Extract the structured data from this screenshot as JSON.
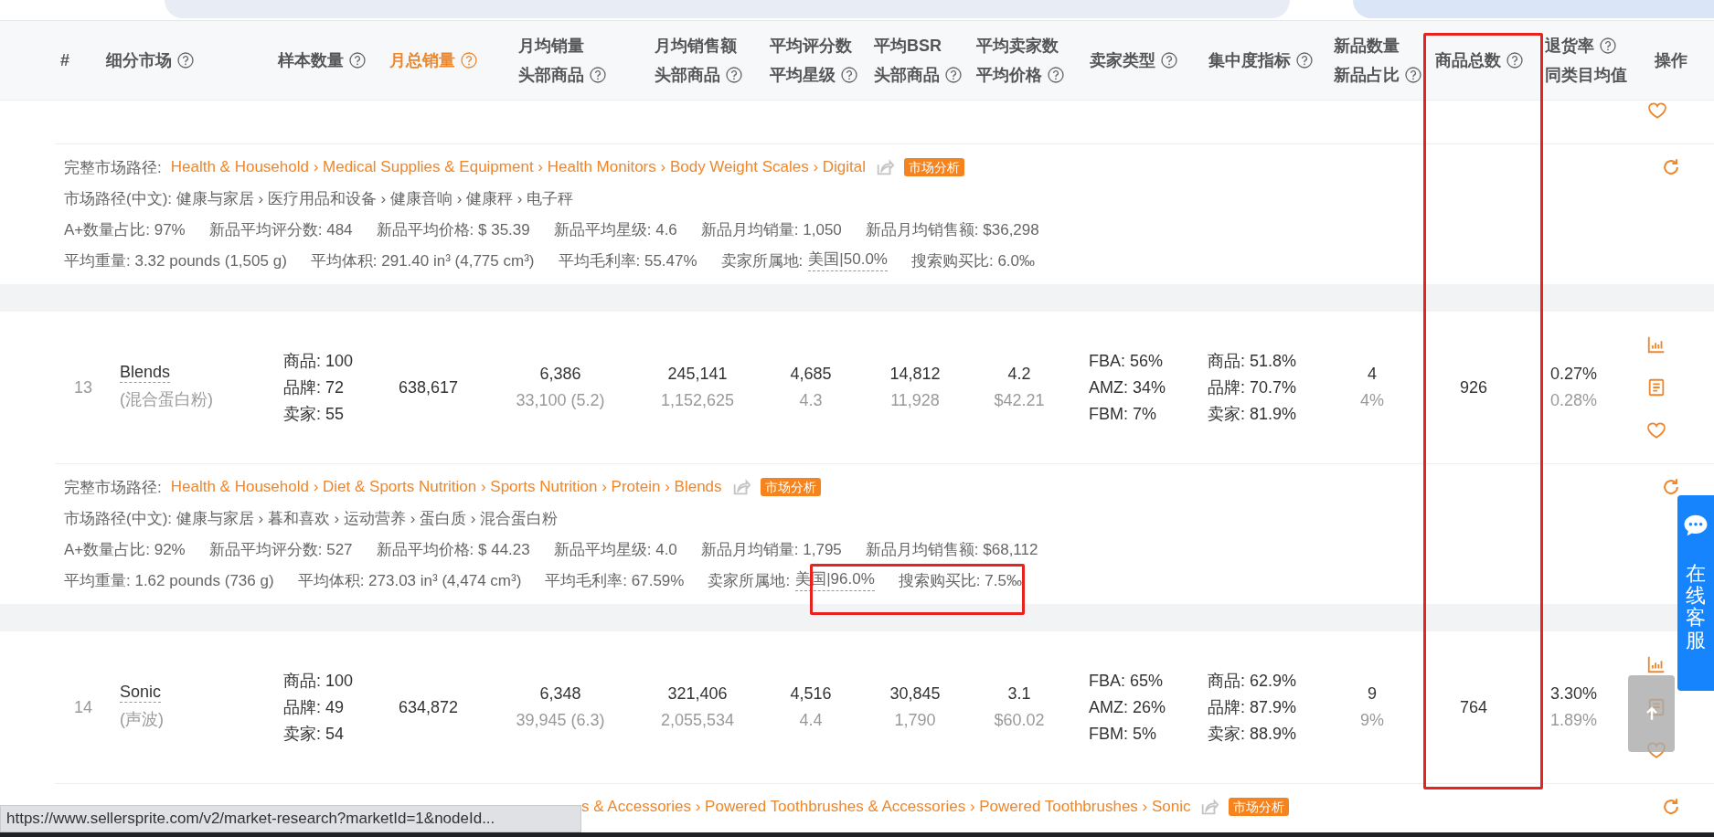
{
  "table": {
    "columns": [
      {
        "lines": [
          {
            "text": "#",
            "help": false
          }
        ],
        "sorted": false
      },
      {
        "lines": [
          {
            "text": "细分市场",
            "help": true
          }
        ],
        "sorted": false
      },
      {
        "lines": [
          {
            "text": "样本数量",
            "help": true
          }
        ],
        "sorted": false
      },
      {
        "lines": [
          {
            "text": "月总销量",
            "help": true
          }
        ],
        "sorted": true
      },
      {
        "lines": [
          {
            "text": "月均销量",
            "help": false
          },
          {
            "text": "头部商品",
            "help": true
          }
        ],
        "sorted": false
      },
      {
        "lines": [
          {
            "text": "月均销售额",
            "help": false
          },
          {
            "text": "头部商品",
            "help": true
          }
        ],
        "sorted": false
      },
      {
        "lines": [
          {
            "text": "平均评分数",
            "help": false
          },
          {
            "text": "平均星级",
            "help": true
          }
        ],
        "sorted": false
      },
      {
        "lines": [
          {
            "text": "平均BSR",
            "help": false
          },
          {
            "text": "头部商品",
            "help": true
          }
        ],
        "sorted": false
      },
      {
        "lines": [
          {
            "text": "平均卖家数",
            "help": false
          },
          {
            "text": "平均价格",
            "help": true
          }
        ],
        "sorted": false
      },
      {
        "lines": [
          {
            "text": "卖家类型",
            "help": true
          }
        ],
        "sorted": false
      },
      {
        "lines": [
          {
            "text": "集中度指标",
            "help": true
          }
        ],
        "sorted": false
      },
      {
        "lines": [
          {
            "text": "新品数量",
            "help": false
          },
          {
            "text": "新品占比",
            "help": true
          }
        ],
        "sorted": false
      },
      {
        "lines": [
          {
            "text": "商品总数",
            "help": true
          }
        ],
        "sorted": false
      },
      {
        "lines": [
          {
            "text": "退货率",
            "help": true
          },
          {
            "text": "同类目均值",
            "help": false
          }
        ],
        "sorted": false
      },
      {
        "lines": [
          {
            "text": "操作",
            "help": false
          }
        ],
        "sorted": false
      }
    ],
    "rows": [
      {
        "kind": "partial",
        "actions": [
          {
            "kind": "heart"
          }
        ],
        "detail": {
          "kind": "full",
          "path_label": "完整市场路径:",
          "path": "Health & Household › Medical Supplies & Equipment › Health Monitors › Body Weight Scales › Digital",
          "badge": "市场分析",
          "lines": [
            [
              {
                "kind": "plain",
                "text": "市场路径(中文): 健康与家居 › 医疗用品和设备 › 健康音响 › 健康秤 › 电子秤"
              }
            ],
            [
              {
                "kind": "plain",
                "text": "A+数量占比: 97%"
              },
              {
                "kind": "plain",
                "text": "新品平均评分数: 484"
              },
              {
                "kind": "plain",
                "text": "新品平均价格: $ 35.39"
              },
              {
                "kind": "plain",
                "text": "新品平均星级: 4.6"
              },
              {
                "kind": "plain",
                "text": "新品月均销量: 1,050"
              },
              {
                "kind": "plain",
                "text": "新品月均销售额: $36,298"
              }
            ],
            [
              {
                "kind": "plain",
                "text": "平均重量: 3.32 pounds (1,505 g)"
              },
              {
                "kind": "plain",
                "text": "平均体积: 291.40 in³ (4,775 cm³)"
              },
              {
                "kind": "plain",
                "text": "平均毛利率: 55.47%"
              },
              {
                "kind": "hover",
                "label": "卖家所属地:",
                "value": "美国|50.0%"
              },
              {
                "kind": "plain",
                "text": "搜索购买比: 6.0‰"
              }
            ]
          ]
        }
      },
      {
        "kind": "full",
        "cells": [
          [
            "13"
          ],
          [
            "Blends",
            "(混合蛋白粉)"
          ],
          [
            "商品: 100",
            "品牌: 72",
            "卖家: 55"
          ],
          [
            "638,617"
          ],
          [
            "6,386",
            "33,100 (5.2)"
          ],
          [
            "245,141",
            "1,152,625"
          ],
          [
            "4,685",
            "4.3"
          ],
          [
            "14,812",
            "11,928"
          ],
          [
            "4.2",
            "$42.21"
          ],
          [
            "FBA: 56%",
            "AMZ: 34%",
            "FBM: 7%"
          ],
          [
            "商品: 51.8%",
            "品牌: 70.7%",
            "卖家: 81.9%"
          ],
          [
            "4",
            "4%"
          ],
          [
            "926"
          ],
          [
            "0.27%",
            "0.28%"
          ]
        ],
        "actions": [
          {
            "kind": "chart"
          },
          {
            "kind": "notes"
          },
          {
            "kind": "heart"
          }
        ],
        "detail": {
          "kind": "full",
          "path_label": "完整市场路径:",
          "path": "Health & Household › Diet & Sports Nutrition › Sports Nutrition › Protein › Blends",
          "badge": "市场分析",
          "lines": [
            [
              {
                "kind": "plain",
                "text": "市场路径(中文): 健康与家居 › 暮和喜欢 › 运动营养 › 蛋白质 › 混合蛋白粉"
              }
            ],
            [
              {
                "kind": "plain",
                "text": "A+数量占比: 92%"
              },
              {
                "kind": "plain",
                "text": "新品平均评分数: 527"
              },
              {
                "kind": "plain",
                "text": "新品平均价格: $ 44.23"
              },
              {
                "kind": "plain",
                "text": "新品平均星级: 4.0"
              },
              {
                "kind": "plain",
                "text": "新品月均销量: 1,795"
              },
              {
                "kind": "plain",
                "text": "新品月均销售额: $68,112"
              }
            ],
            [
              {
                "kind": "plain",
                "text": "平均重量: 1.62 pounds (736 g)"
              },
              {
                "kind": "plain",
                "text": "平均体积: 273.03 in³ (4,474 cm³)"
              },
              {
                "kind": "plain",
                "text": "平均毛利率: 67.59%"
              },
              {
                "kind": "hover",
                "label": "卖家所属地:",
                "value": "美国|96.0%"
              },
              {
                "kind": "plain",
                "text": "搜索购买比: 7.5‰"
              }
            ]
          ]
        }
      },
      {
        "kind": "full",
        "cells": [
          [
            "14"
          ],
          [
            "Sonic",
            "(声波)"
          ],
          [
            "商品: 100",
            "品牌: 49",
            "卖家: 54"
          ],
          [
            "634,872"
          ],
          [
            "6,348",
            "39,945 (6.3)"
          ],
          [
            "321,406",
            "2,055,534"
          ],
          [
            "4,516",
            "4.4"
          ],
          [
            "30,845",
            "1,790"
          ],
          [
            "3.1",
            "$60.02"
          ],
          [
            "FBA: 65%",
            "AMZ: 26%",
            "FBM: 5%"
          ],
          [
            "商品: 62.9%",
            "品牌: 87.9%",
            "卖家: 88.9%"
          ],
          [
            "9",
            "9%"
          ],
          [
            "764"
          ],
          [
            "3.30%",
            "1.89%"
          ]
        ],
        "actions": [
          {
            "kind": "chart"
          },
          {
            "kind": "notes"
          },
          {
            "kind": "heart"
          }
        ],
        "detail": {
          "kind": "clipped",
          "path": "s & Accessories › Powered Toothbrushes & Accessories › Powered Toothbrushes › Sonic",
          "badge": "市场分析"
        }
      }
    ]
  },
  "chat_widget": {
    "label": "在线客服"
  },
  "status_bar": {
    "url": "https://www.sellersprite.com/v2/market-research?marketId=1&nodeId..."
  }
}
